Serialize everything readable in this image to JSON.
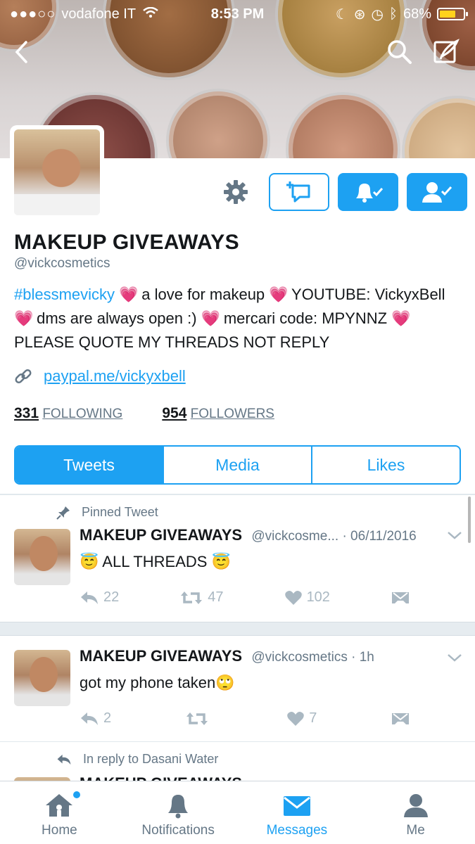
{
  "status_bar": {
    "carrier": "vodafone IT",
    "time": "8:53 PM",
    "battery": "68%",
    "signal_dots": "●●●○○"
  },
  "profile": {
    "name": "MAKEUP GIVEAWAYS",
    "handle": "@vickcosmetics",
    "bio": {
      "hashtag": "#blessmevicky",
      "p1": "a love for makeup",
      "p2": "YOUTUBE:",
      "p3": "VickyxBell",
      "p4": "dms are always open :)",
      "p5": "mercari code:",
      "p6": "MPYNNZ",
      "p7": "PLEASE QUOTE MY THREADS NOT REPLY",
      "heart": "💗"
    },
    "link": "paypal.me/vickyxbell",
    "following_count": "331",
    "following_label": "FOLLOWING",
    "followers_count": "954",
    "followers_label": "FOLLOWERS"
  },
  "tabs": [
    "Tweets",
    "Media",
    "Likes"
  ],
  "tweets": [
    {
      "context": "Pinned Tweet",
      "name": "MAKEUP GIVEAWAYS",
      "handle": "@vickcosme...",
      "time": "· 06/11/2016",
      "text": "😇 ALL THREADS 😇",
      "replies": "22",
      "retweets": "47",
      "likes": "102"
    },
    {
      "name": "MAKEUP GIVEAWAYS",
      "handle": "@vickcosmetics",
      "time": "· 1h",
      "text": "got my phone taken🙄",
      "replies": "2",
      "retweets": "",
      "likes": "7"
    },
    {
      "context": "In reply to Dasani Water",
      "name": "MAKEUP GIVEAWAYS"
    }
  ],
  "bottom_nav": [
    "Home",
    "Notifications",
    "Messages",
    "Me"
  ],
  "colors": {
    "accent": "#1da1f2",
    "muted": "#657786",
    "icon_gray": "#aab8c2"
  }
}
